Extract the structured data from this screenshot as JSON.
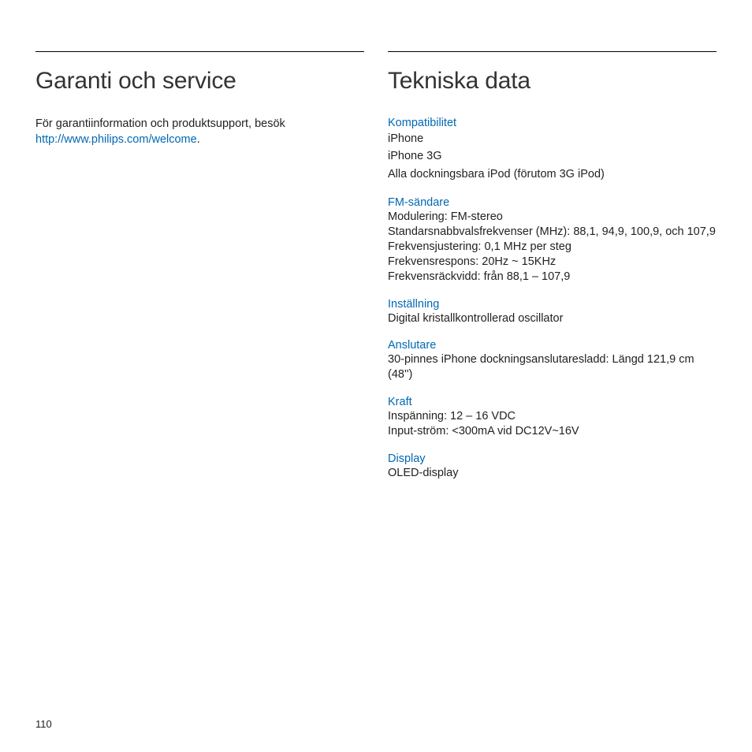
{
  "page_number": "110",
  "left": {
    "heading": "Garanti och service",
    "intro_before_link": "För garantiinformation och produktsupport, besök ",
    "link_text": "http://www.philips.com/welcome",
    "intro_after_link": "."
  },
  "right": {
    "heading": "Tekniska data",
    "sections": [
      {
        "title": "Kompatibilitet",
        "lines": [
          "iPhone",
          "iPhone 3G",
          "Alla dockningsbara iPod (förutom 3G iPod)"
        ],
        "loose": true
      },
      {
        "title": "FM-sändare",
        "lines": [
          "Modulering: FM-stereo",
          "Standarsnabbvalsfrekvenser (MHz): 88,1, 94,9, 100,9, och 107,9",
          "Frekvensjustering: 0,1 MHz per steg",
          "Frekvensrespons: 20Hz ~ 15KHz",
          "Frekvensräckvidd: från 88,1 – 107,9"
        ],
        "loose": false
      },
      {
        "title": "Inställning",
        "lines": [
          "Digital kristallkontrollerad oscillator"
        ],
        "loose": false
      },
      {
        "title": "Anslutare",
        "lines": [
          "30-pinnes iPhone dockningsanslutaresladd: Längd 121,9 cm (48'')"
        ],
        "loose": false
      },
      {
        "title": "Kraft",
        "lines": [
          "Inspänning: 12 – 16 VDC",
          "Input-ström: <300mA vid DC12V~16V"
        ],
        "loose": false
      },
      {
        "title": "Display",
        "lines": [
          "OLED-display"
        ],
        "loose": false
      }
    ]
  }
}
